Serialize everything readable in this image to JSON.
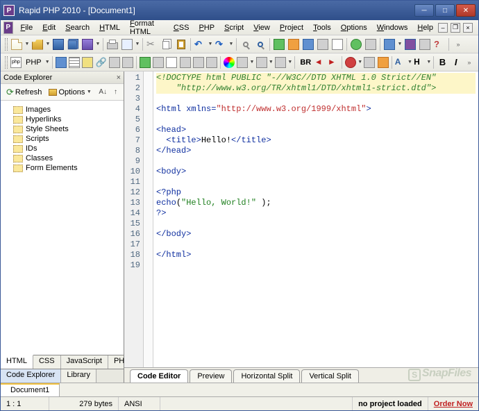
{
  "title": "Rapid PHP 2010 - [Document1]",
  "menu": [
    "File",
    "Edit",
    "Search",
    "HTML",
    "Format HTML",
    "CSS",
    "PHP",
    "Script",
    "View",
    "Project",
    "Tools",
    "Options",
    "Windows",
    "Help"
  ],
  "toolbar2_label": "PHP",
  "toolbar2_br": "BR",
  "sidebar": {
    "title": "Code Explorer",
    "refresh": "Refresh",
    "options": "Options",
    "items": [
      "Images",
      "Hyperlinks",
      "Style Sheets",
      "Scripts",
      "IDs",
      "Classes",
      "Form Elements"
    ],
    "lang_tabs": [
      "HTML",
      "CSS",
      "JavaScript",
      "PHP"
    ],
    "panel_tabs": [
      "Code Explorer",
      "Library"
    ]
  },
  "code_lines": [
    {
      "n": 1,
      "hl": true,
      "cls": "c-doctype",
      "t": "<!DOCTYPE html PUBLIC \"-//W3C//DTD XHTML 1.0 Strict//EN\""
    },
    {
      "n": 2,
      "hl": true,
      "cls": "c-doctype",
      "t": "    \"http://www.w3.org/TR/xhtml1/DTD/xhtml1-strict.dtd\">"
    },
    {
      "n": 3,
      "t": ""
    },
    {
      "n": 4,
      "html": "<span class='c-tag'>&lt;html</span> <span class='c-attr'>xmlns=</span><span class='c-str'>\"http://www.w3.org/1999/xhtml\"</span><span class='c-tag'>&gt;</span>"
    },
    {
      "n": 5,
      "t": ""
    },
    {
      "n": 6,
      "html": "<span class='c-tag'>&lt;head&gt;</span>"
    },
    {
      "n": 7,
      "html": "  <span class='c-tag'>&lt;title&gt;</span><span class='c-text'>Hello!</span><span class='c-tag'>&lt;/title&gt;</span>"
    },
    {
      "n": 8,
      "html": "<span class='c-tag'>&lt;/head&gt;</span>"
    },
    {
      "n": 9,
      "t": ""
    },
    {
      "n": 10,
      "html": "<span class='c-tag'>&lt;body&gt;</span>"
    },
    {
      "n": 11,
      "t": ""
    },
    {
      "n": 12,
      "html": "<span class='c-php'>&lt;?php</span>"
    },
    {
      "n": 13,
      "html": "<span class='c-php'>echo</span><span class='c-text'>(</span><span class='c-phpstr'>\"Hello, World!\"</span> <span class='c-text'>);</span>"
    },
    {
      "n": 14,
      "html": "<span class='c-php'>?&gt;</span>"
    },
    {
      "n": 15,
      "t": ""
    },
    {
      "n": 16,
      "html": "<span class='c-tag'>&lt;/body&gt;</span>"
    },
    {
      "n": 17,
      "t": ""
    },
    {
      "n": 18,
      "html": "<span class='c-tag'>&lt;/html&gt;</span>"
    },
    {
      "n": 19,
      "t": ""
    }
  ],
  "editor_tabs": [
    "Code Editor",
    "Preview",
    "Horizontal Split",
    "Vertical Split"
  ],
  "doc_tab": "Document1",
  "status": {
    "pos": "1 : 1",
    "size": "279 bytes",
    "enc": "ANSI",
    "project": "no project loaded",
    "order": "Order Now"
  },
  "watermark": "SnapFiles"
}
